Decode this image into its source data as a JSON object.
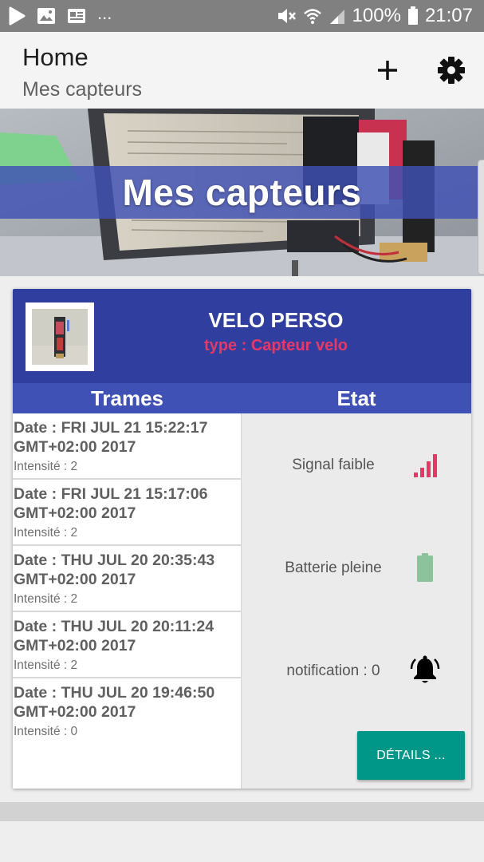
{
  "status_bar": {
    "left_icons": [
      "play-icon",
      "image-icon",
      "news-icon"
    ],
    "overflow": "...",
    "battery_percent": "100%",
    "time": "21:07"
  },
  "app_bar": {
    "title": "Home",
    "subtitle": "Mes capteurs",
    "actions": [
      "add-icon",
      "settings-icon"
    ]
  },
  "hero": {
    "banner_text": "Mes capteurs"
  },
  "sensor_card": {
    "name": "VELO PERSO",
    "type": "type : Capteur velo",
    "columns": {
      "frames": "Trames",
      "state": "Etat"
    },
    "frames": [
      {
        "date": "Date : FRI JUL 21 15:22:17 GMT+02:00 2017",
        "intensity": "Intensité : 2"
      },
      {
        "date": "Date : FRI JUL 21 15:17:06 GMT+02:00 2017",
        "intensity": "Intensité : 2"
      },
      {
        "date": "Date : THU JUL 20 20:35:43 GMT+02:00 2017",
        "intensity": "Intensité : 2"
      },
      {
        "date": "Date : THU JUL 20 20:11:24 GMT+02:00 2017",
        "intensity": "Intensité : 2"
      },
      {
        "date": "Date : THU JUL 20 19:46:50 GMT+02:00 2017",
        "intensity": "Intensité : 0"
      }
    ],
    "state": {
      "signal": {
        "label": "Signal faible",
        "icon": "signal-bars-icon",
        "color": "#e53967"
      },
      "battery": {
        "label": "Batterie pleine",
        "icon": "battery-full-icon",
        "color": "#8bc49a"
      },
      "notification": {
        "label": "notification : 0",
        "icon": "bell-icon",
        "color": "#000000"
      }
    },
    "details_button": "DÉTAILS ..."
  },
  "colors": {
    "primary_dark": "#303f9f",
    "primary": "#3f51b5",
    "accent_pink": "#e53967",
    "button_teal": "#009688",
    "status_bar": "#808080"
  }
}
